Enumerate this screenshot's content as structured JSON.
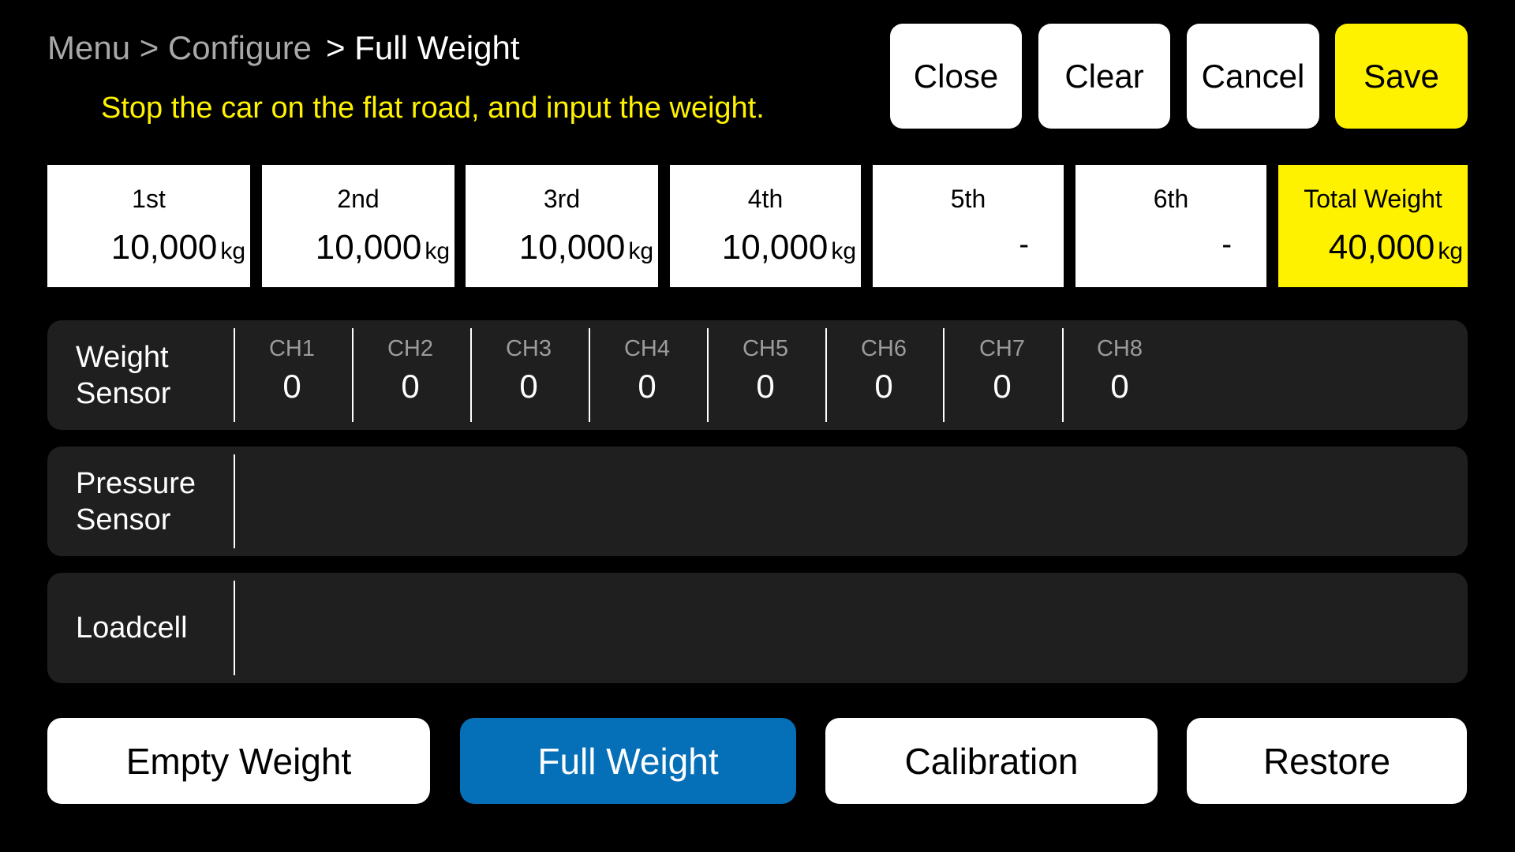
{
  "breadcrumb": {
    "parent": "Menu > Configure",
    "current": "> Full Weight"
  },
  "hint": "Stop the car on the flat road, and input the weight.",
  "toolbar": {
    "close_label": "Close",
    "clear_label": "Clear",
    "cancel_label": "Cancel",
    "save_label": "Save"
  },
  "axles": [
    {
      "label": "1st",
      "value": "10,000",
      "unit": "kg"
    },
    {
      "label": "2nd",
      "value": "10,000",
      "unit": "kg"
    },
    {
      "label": "3rd",
      "value": "10,000",
      "unit": "kg"
    },
    {
      "label": "4th",
      "value": "10,000",
      "unit": "kg"
    },
    {
      "label": "5th",
      "value": "-",
      "unit": ""
    },
    {
      "label": "6th",
      "value": "-",
      "unit": ""
    }
  ],
  "total": {
    "label": "Total Weight",
    "value": "40,000",
    "unit": "kg"
  },
  "sensors": {
    "weight": {
      "label_line1": "Weight",
      "label_line2": "Sensor",
      "channels": [
        {
          "name": "CH1",
          "value": "0"
        },
        {
          "name": "CH2",
          "value": "0"
        },
        {
          "name": "CH3",
          "value": "0"
        },
        {
          "name": "CH4",
          "value": "0"
        },
        {
          "name": "CH5",
          "value": "0"
        },
        {
          "name": "CH6",
          "value": "0"
        },
        {
          "name": "CH7",
          "value": "0"
        },
        {
          "name": "CH8",
          "value": "0"
        }
      ]
    },
    "pressure": {
      "label_line1": "Pressure",
      "label_line2": "Sensor"
    },
    "loadcell": {
      "label_line1": "Loadcell"
    }
  },
  "modes": {
    "empty_label": "Empty Weight",
    "full_label": "Full Weight",
    "calibration_label": "Calibration",
    "restore_label": "Restore",
    "active": "Full Weight"
  },
  "colors": {
    "accent_yellow": "#fff200",
    "active_blue": "#0570b8",
    "panel_bg": "#1f1f1f"
  }
}
